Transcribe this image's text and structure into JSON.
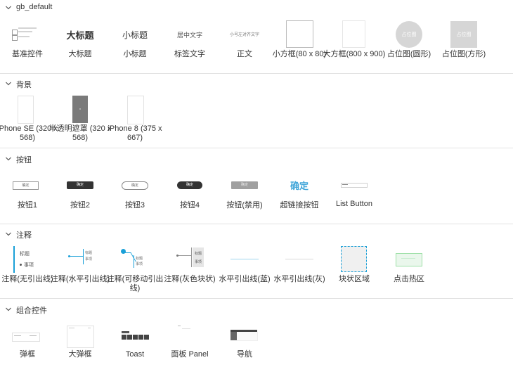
{
  "sections": [
    {
      "title": "gb_default",
      "items": [
        {
          "label": "基准控件"
        },
        {
          "label": "大标题",
          "thumb_text": "大标题"
        },
        {
          "label": "小标题",
          "thumb_text": "小标题"
        },
        {
          "label": "标签文字",
          "thumb_text": "居中文字"
        },
        {
          "label": "正文",
          "thumb_text": "小号左对齐文字"
        },
        {
          "label": "小方框(80 x 80)"
        },
        {
          "label": "大方框(800 x 900)"
        },
        {
          "label": "占位图(圆形)",
          "thumb_text": "占位图"
        },
        {
          "label": "占位图(方形)",
          "thumb_text": "占位图"
        }
      ]
    },
    {
      "title": "背景",
      "items": [
        {
          "label": "iPhone SE (320 x 568)"
        },
        {
          "label": "半透明遮罩 (320 x 568)"
        },
        {
          "label": "iPhone 8 (375 x 667)"
        }
      ]
    },
    {
      "title": "按钮",
      "items": [
        {
          "label": "按钮1",
          "thumb_text": "确定"
        },
        {
          "label": "按钮2",
          "thumb_text": "确定"
        },
        {
          "label": "按钮3",
          "thumb_text": "确定"
        },
        {
          "label": "按钮4",
          "thumb_text": "确定"
        },
        {
          "label": "按钮(禁用)",
          "thumb_text": "确定"
        },
        {
          "label": "超链接按钮",
          "thumb_text": "确定"
        },
        {
          "label": "List Button"
        }
      ]
    },
    {
      "title": "注释",
      "items": [
        {
          "label": "注释(无引出线)",
          "thumb_title": "标题",
          "thumb_item": "事项"
        },
        {
          "label": "注释(水平引出线)",
          "thumb_title": "标题",
          "thumb_item": "事项"
        },
        {
          "label": "注释(可移动引出线)",
          "thumb_title": "标题",
          "thumb_item": "事项"
        },
        {
          "label": "注释(灰色块状)",
          "thumb_title": "标题",
          "thumb_item": "事项"
        },
        {
          "label": "水平引出线(蓝)"
        },
        {
          "label": "水平引出线(灰)"
        },
        {
          "label": "块状区域"
        },
        {
          "label": "点击热区"
        }
      ]
    },
    {
      "title": "组合控件",
      "items": [
        {
          "label": "弹框"
        },
        {
          "label": "大弹框"
        },
        {
          "label": "Toast"
        },
        {
          "label": "面板 Panel"
        },
        {
          "label": "导航"
        }
      ]
    }
  ],
  "colors": {
    "accent_blue": "#1aa0d8",
    "link_blue": "#41a6d9",
    "dark_button": "#333333",
    "disabled_gray": "#a0a0a0",
    "placeholder_gray": "#d6d6d6",
    "hotspot_green": "#9ee0a8"
  }
}
